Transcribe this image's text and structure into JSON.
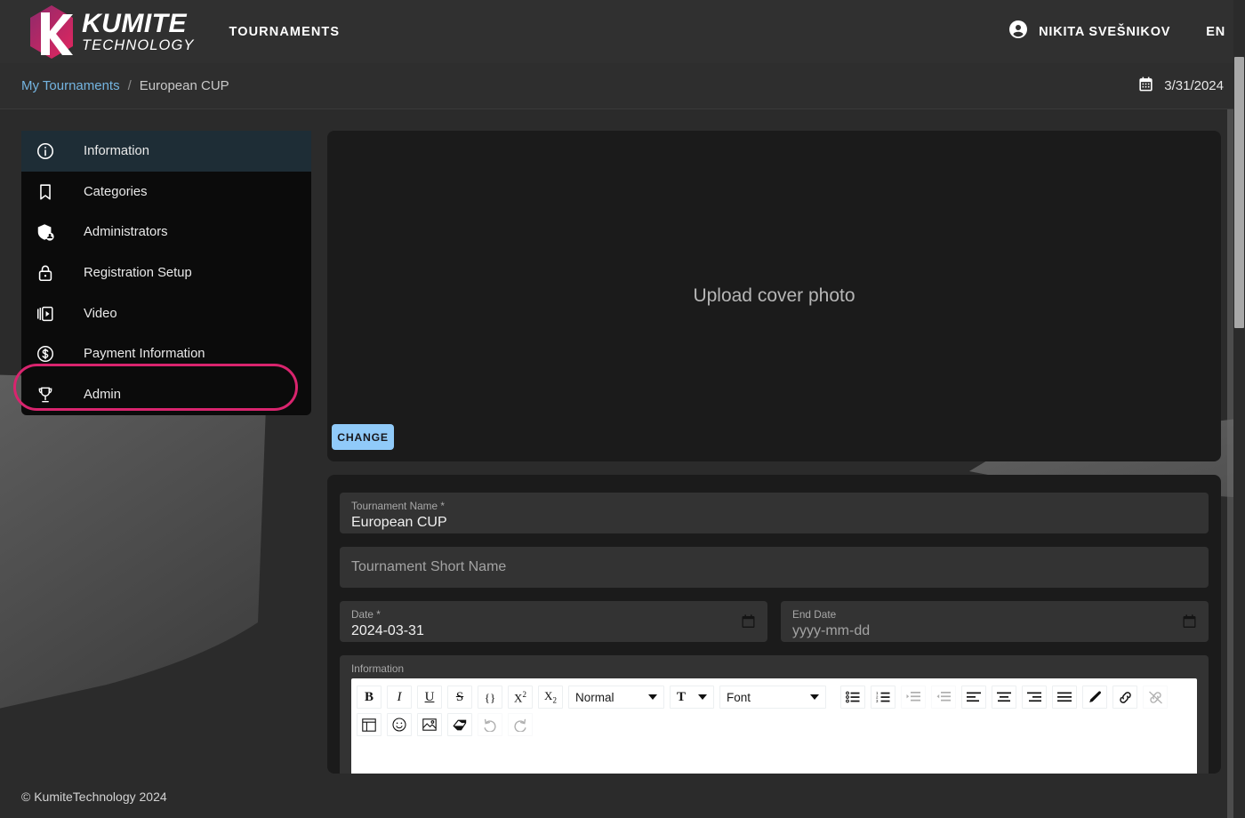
{
  "brand": {
    "name_line1": "KUMITE",
    "name_line2": "TECHNOLOGY",
    "logo_icon": "kumite-hex-k-logo",
    "gradient_start": "#8e2a6b",
    "gradient_end": "#e3265f"
  },
  "topbar": {
    "nav_tournaments": "TOURNAMENTS",
    "user_name": "NIKITA SVEŠNIKOV",
    "user_icon": "account-circle-icon",
    "language": "EN",
    "background": "#303030"
  },
  "breadcrumb": {
    "root": "My Tournaments",
    "separator": "/",
    "current": "European CUP",
    "link_color": "#74b4e0",
    "date_icon": "calendar-icon",
    "date": "3/31/2024"
  },
  "sidebar": {
    "items": [
      {
        "label": "Information",
        "icon": "info-circle-icon",
        "active": true,
        "highlighted": false
      },
      {
        "label": "Categories",
        "icon": "bookmark-icon",
        "active": false,
        "highlighted": false
      },
      {
        "label": "Administrators",
        "icon": "admin-shield-icon",
        "active": false,
        "highlighted": false
      },
      {
        "label": "Registration Setup",
        "icon": "lock-icon",
        "active": false,
        "highlighted": false
      },
      {
        "label": "Video",
        "icon": "video-library-icon",
        "active": false,
        "highlighted": false
      },
      {
        "label": "Payment Information",
        "icon": "dollar-circle-icon",
        "active": false,
        "highlighted": false
      },
      {
        "label": "Admin",
        "icon": "trophy-icon",
        "active": false,
        "highlighted": true
      }
    ],
    "highlight_color": "#d9246e",
    "active_background": "#1e2d36"
  },
  "cover": {
    "placeholder": "Upload cover photo",
    "change_label": "CHANGE",
    "change_color": "#90caf9"
  },
  "form": {
    "tournament_name": {
      "label": "Tournament Name *",
      "value": "European CUP"
    },
    "tournament_short_name": {
      "label": "",
      "placeholder": "Tournament Short Name",
      "value": ""
    },
    "date": {
      "label": "Date *",
      "value": "2024-03-31",
      "icon": "calendar-picker-icon"
    },
    "end_date": {
      "label": "End Date",
      "value": "yyyy-mm-dd",
      "is_placeholder": true,
      "icon": "calendar-picker-icon"
    },
    "information": {
      "label": "Information"
    }
  },
  "editor": {
    "row1": [
      {
        "name": "bold-icon",
        "glyph": "B",
        "style": "bold",
        "disabled": false
      },
      {
        "name": "italic-icon",
        "glyph": "I",
        "style": "italic",
        "disabled": false
      },
      {
        "name": "underline-icon",
        "glyph": "U",
        "style": "underline",
        "disabled": false
      },
      {
        "name": "strikethrough-icon",
        "glyph": "S",
        "style": "strike",
        "disabled": false
      },
      {
        "name": "code-block-icon",
        "glyph": "{}",
        "style": "plain",
        "disabled": false
      },
      {
        "name": "superscript-icon",
        "glyph": "X",
        "style": "sup",
        "disabled": false
      },
      {
        "name": "subscript-icon",
        "glyph": "X",
        "style": "sub",
        "disabled": false
      }
    ],
    "select_header": {
      "name": "header-select",
      "value": "Normal"
    },
    "select_size": {
      "name": "font-size-select",
      "value": "T"
    },
    "select_font": {
      "name": "font-family-select",
      "value": "Font"
    },
    "row1b": [
      {
        "name": "bullet-list-icon",
        "glyph": "bullet",
        "disabled": false
      },
      {
        "name": "ordered-list-icon",
        "glyph": "ordered",
        "disabled": false
      },
      {
        "name": "indent-increase-icon",
        "glyph": "indent-r",
        "disabled": true
      },
      {
        "name": "indent-decrease-icon",
        "glyph": "indent-l",
        "disabled": true
      },
      {
        "name": "align-left-icon",
        "glyph": "al",
        "disabled": false
      },
      {
        "name": "align-center-icon",
        "glyph": "ac",
        "disabled": false
      },
      {
        "name": "align-right-icon",
        "glyph": "ar",
        "disabled": false
      },
      {
        "name": "align-justify-icon",
        "glyph": "aj",
        "disabled": false
      },
      {
        "name": "highlight-pen-icon",
        "glyph": "pen",
        "disabled": false
      },
      {
        "name": "link-icon",
        "glyph": "link",
        "disabled": false
      },
      {
        "name": "unlink-icon",
        "glyph": "unlink",
        "disabled": true
      }
    ],
    "row2": [
      {
        "name": "insert-table-icon",
        "glyph": "table",
        "disabled": false
      },
      {
        "name": "emoji-icon",
        "glyph": "emoji",
        "disabled": false
      },
      {
        "name": "insert-image-icon",
        "glyph": "image",
        "disabled": false
      },
      {
        "name": "clear-format-icon",
        "glyph": "eraser",
        "disabled": false
      },
      {
        "name": "undo-icon",
        "glyph": "undo",
        "disabled": true
      },
      {
        "name": "redo-icon",
        "glyph": "redo",
        "disabled": true
      }
    ]
  },
  "footer": {
    "copyright": "© KumiteTechnology 2024"
  },
  "scrollbar": {
    "name": "page-scrollbar"
  }
}
